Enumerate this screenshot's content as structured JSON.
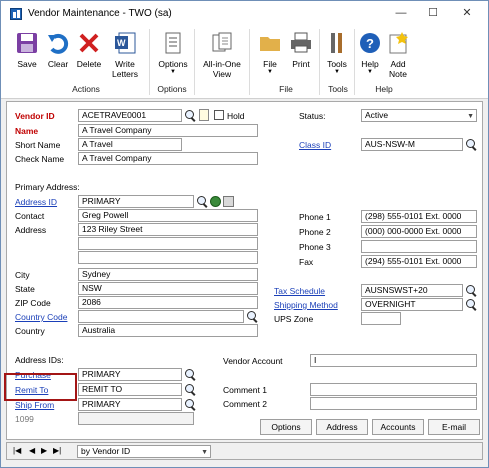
{
  "window": {
    "title": "Vendor Maintenance  -  TWO (sa)",
    "minimize": "—",
    "maximize": "☐",
    "close": "✕"
  },
  "ribbon": {
    "save": "Save",
    "clear": "Clear",
    "delete": "Delete",
    "write_letters": "Write\nLetters",
    "options": "Options",
    "all_in_one": "All-in-One\nView",
    "file": "File",
    "print": "Print",
    "tools": "Tools",
    "help": "Help",
    "add_note": "Add\nNote",
    "groups": {
      "actions": "Actions",
      "options": "Options",
      "file": "File",
      "tools": "Tools",
      "help": "Help"
    }
  },
  "form": {
    "vendor_id": {
      "label": "Vendor ID",
      "value": "ACETRAVE0001"
    },
    "hold": {
      "label": "Hold",
      "checked": false
    },
    "name": {
      "label": "Name",
      "value": "A Travel Company"
    },
    "short_name": {
      "label": "Short Name",
      "value": "A Travel"
    },
    "check_name": {
      "label": "Check Name",
      "value": "A Travel Company"
    },
    "status": {
      "label": "Status:",
      "value": "Active"
    },
    "class_id": {
      "label": "Class ID",
      "value": "AUS-NSW-M"
    },
    "primary_address_label": "Primary Address:",
    "address_id": {
      "label": "Address ID",
      "value": "PRIMARY"
    },
    "contact": {
      "label": "Contact",
      "value": "Greg Powell"
    },
    "address": {
      "label": "Address",
      "line1": "123 Riley Street",
      "line2": "",
      "line3": ""
    },
    "city": {
      "label": "City",
      "value": "Sydney"
    },
    "state": {
      "label": "State",
      "value": "NSW"
    },
    "zip": {
      "label": "ZIP Code",
      "value": "2086"
    },
    "country_code": {
      "label": "Country Code",
      "value": ""
    },
    "country": {
      "label": "Country",
      "value": "Australia"
    },
    "phone1": {
      "label": "Phone 1",
      "value": "(298) 555-0101  Ext. 0000"
    },
    "phone2": {
      "label": "Phone 2",
      "value": "(000) 000-0000  Ext. 0000"
    },
    "phone3": {
      "label": "Phone 3",
      "value": ""
    },
    "fax": {
      "label": "Fax",
      "value": "(294) 555-0101  Ext. 0000"
    },
    "tax_schedule": {
      "label": "Tax Schedule",
      "value": "AUSNSWST+20"
    },
    "shipping_method": {
      "label": "Shipping Method",
      "value": "OVERNIGHT"
    },
    "ups_zone": {
      "label": "UPS Zone",
      "value": ""
    },
    "address_ids_label": "Address IDs:",
    "purchase": {
      "label": "Purchase",
      "value": "PRIMARY"
    },
    "remit_to": {
      "label": "Remit To",
      "value": "REMIT TO"
    },
    "ship_from": {
      "label": "Ship From",
      "value": "PRIMARY"
    },
    "f1099": {
      "label": "1099",
      "value": ""
    },
    "vendor_account": {
      "label": "Vendor Account",
      "value": "I"
    },
    "comment1": {
      "label": "Comment 1",
      "value": ""
    },
    "comment2": {
      "label": "Comment 2",
      "value": ""
    },
    "buttons": {
      "options": "Options",
      "address": "Address",
      "accounts": "Accounts",
      "email": "E-mail"
    }
  },
  "bottom": {
    "sort": "by Vendor ID",
    "first": "|◀",
    "prev": "◀",
    "next": "▶",
    "last": "▶|"
  }
}
